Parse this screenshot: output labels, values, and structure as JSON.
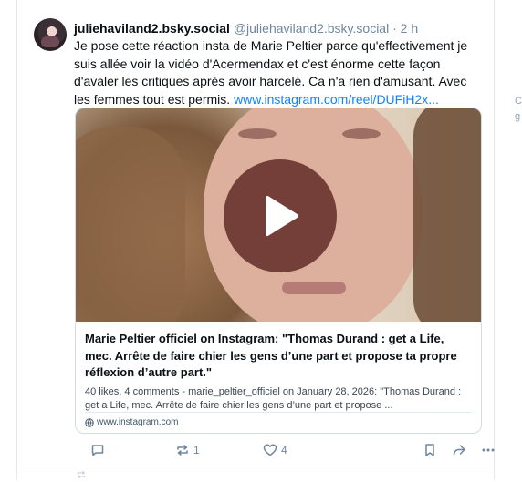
{
  "post": {
    "display_name": "juliehaviland2.bsky.social",
    "handle": "@juliehaviland2.bsky.social",
    "separator": "·",
    "time": "2 h",
    "text": "Je pose cette réaction insta de Marie Peltier parce qu'effectivement je suis allée voir la vidéo d'Acermendax et c'est énorme cette façon d'avaler les critiques après avoir harcelé. Ca n'a rien d'amusant. Avec les femmes tout est permis. ",
    "link": "www.instagram.com/reel/DUFiH2x..."
  },
  "card": {
    "title": "Marie Peltier officiel on Instagram: \"Thomas Durand : get a Life, mec. Arrête de faire chier les gens d’une part et propose ta propre réflexion d’autre part.\"",
    "description": "40 likes, 4 comments - marie_peltier_officiel on January 28, 2026: \"Thomas Durand : get a Life, mec. Arrête de faire chier les gens d’une part et propose ...",
    "source": "www.instagram.com"
  },
  "actions": {
    "repost_count": "1",
    "like_count": "4"
  },
  "right_stub": {
    "line1": "C",
    "line2": "g"
  },
  "colors": {
    "link": "#1083fe",
    "muted": "#6f869f",
    "play_bg": "#561e1e"
  }
}
